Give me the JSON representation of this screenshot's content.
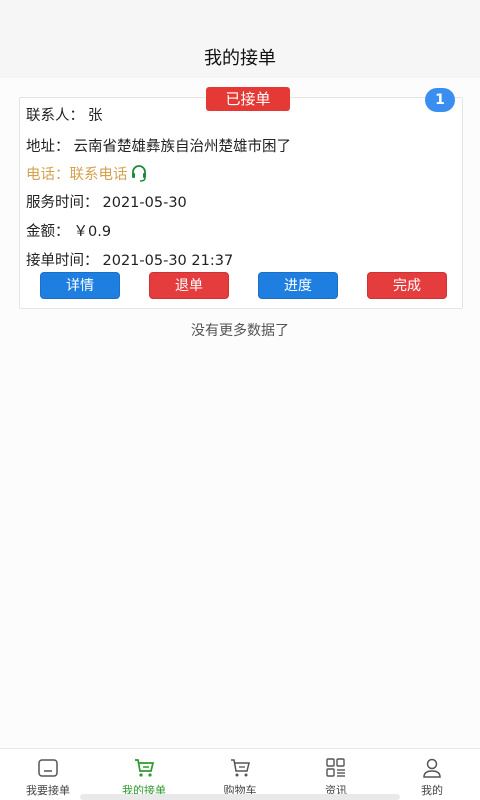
{
  "header": {
    "title": "我的接单"
  },
  "order": {
    "status": "已接单",
    "index": "1",
    "contact_label": "联系人：",
    "contact_value": "张",
    "address_label": "地址：",
    "address_value": "云南省楚雄彝族自治州楚雄市困了",
    "phone_label": "电话：",
    "phone_value": "联系电话",
    "service_time_label": "服务时间：",
    "service_time_value": "2021-05-30",
    "amount_label": "金额：",
    "amount_value": "￥0.9",
    "accept_time_label": "接单时间：",
    "accept_time_value": "2021-05-30 21:37",
    "buttons": {
      "detail": "详情",
      "cancel": "退单",
      "progress": "进度",
      "complete": "完成"
    }
  },
  "list_end": "没有更多数据了",
  "tabbar": {
    "active": "my-orders",
    "accent_color": "#2e9a2e",
    "items": [
      {
        "label": "我要接单",
        "icon": "inbox-icon"
      },
      {
        "label": "我的接单",
        "icon": "cart-active-icon"
      },
      {
        "label": "购物车",
        "icon": "cart-icon"
      },
      {
        "label": "资讯",
        "icon": "grid-icon"
      },
      {
        "label": "我的",
        "icon": "user-icon"
      }
    ]
  }
}
